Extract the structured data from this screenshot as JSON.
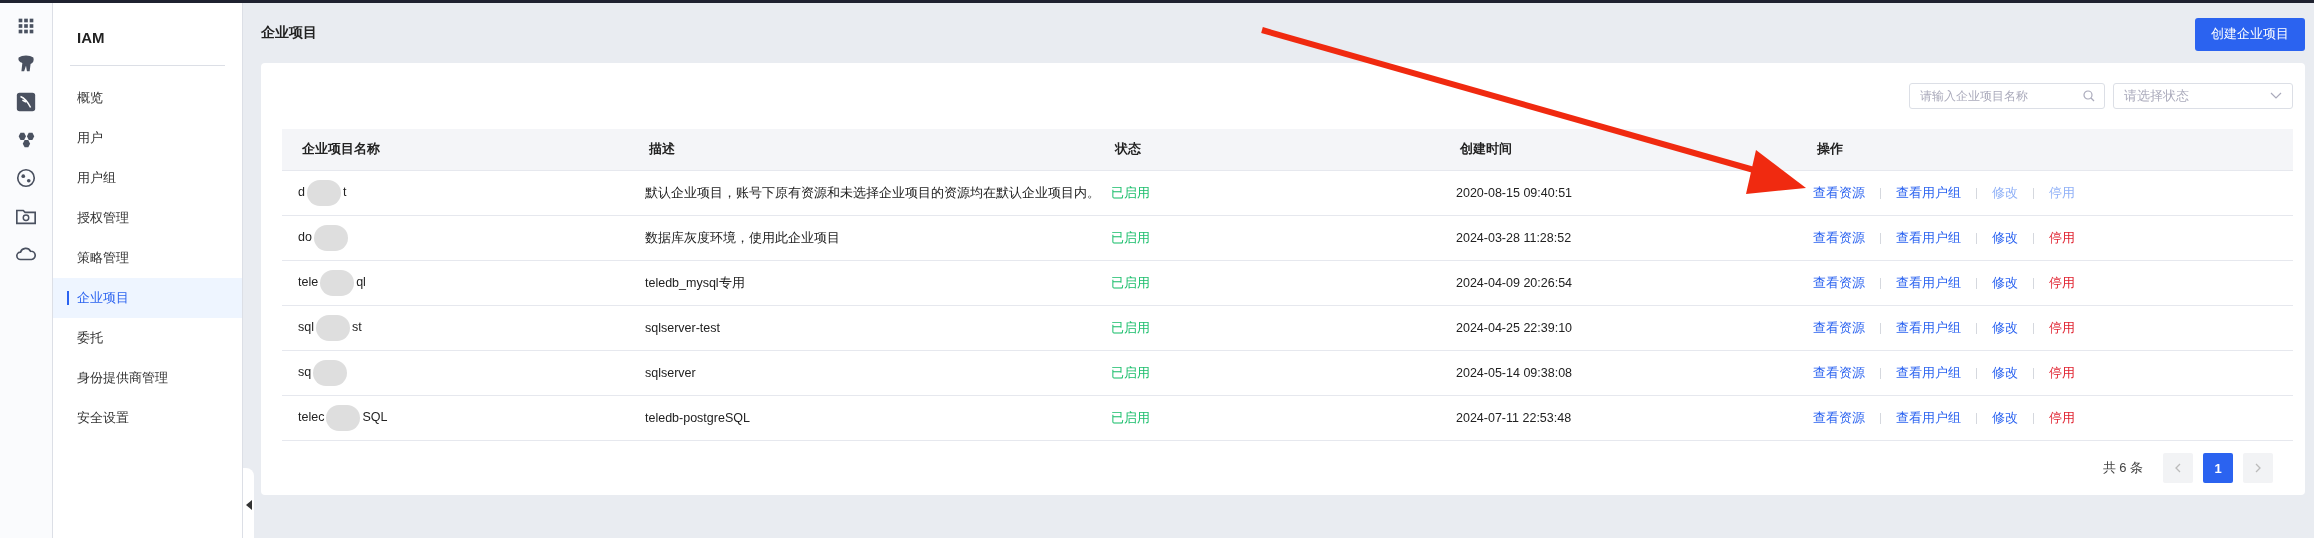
{
  "rail": {
    "icons": [
      {
        "kind": "grid",
        "selected": false
      },
      {
        "kind": "elephant",
        "selected": false
      },
      {
        "kind": "dolphin",
        "selected": false
      },
      {
        "kind": "hexagons",
        "selected": false
      },
      {
        "kind": "orbit",
        "selected": false
      },
      {
        "kind": "folder",
        "selected": false
      },
      {
        "kind": "cloud",
        "selected": false
      }
    ]
  },
  "sidebar": {
    "title": "IAM",
    "items": [
      {
        "label": "概览",
        "selected": false
      },
      {
        "label": "用户",
        "selected": false
      },
      {
        "label": "用户组",
        "selected": false
      },
      {
        "label": "授权管理",
        "selected": false
      },
      {
        "label": "策略管理",
        "selected": false
      },
      {
        "label": "企业项目",
        "selected": true
      },
      {
        "label": "委托",
        "selected": false
      },
      {
        "label": "身份提供商管理",
        "selected": false
      },
      {
        "label": "安全设置",
        "selected": false
      }
    ]
  },
  "page": {
    "title": "企业项目",
    "create_button": "创建企业项目"
  },
  "filters": {
    "search": {
      "placeholder": "请输入企业项目名称"
    },
    "status": {
      "placeholder": "请选择状态"
    }
  },
  "table": {
    "columns": [
      "企业项目名称",
      "描述",
      "状态",
      "创建时间",
      "操作"
    ],
    "rows": [
      {
        "name_parts": [
          "d",
          "t"
        ],
        "description": "默认企业项目，账号下原有资源和未选择企业项目的资源均在默认企业项目内。",
        "status": "已启用",
        "created": "2020-08-15 09:40:51",
        "actions": [
          {
            "label": "查看资源",
            "kind": "link",
            "disabled": false
          },
          {
            "label": "查看用户组",
            "kind": "link",
            "disabled": false
          },
          {
            "label": "修改",
            "kind": "link",
            "disabled": true
          },
          {
            "label": "停用",
            "kind": "danger",
            "disabled": true
          }
        ]
      },
      {
        "name_parts": [
          "do"
        ],
        "description": "数据库灰度环境，使用此企业项目",
        "status": "已启用",
        "created": "2024-03-28 11:28:52",
        "actions": [
          {
            "label": "查看资源",
            "kind": "link",
            "disabled": false
          },
          {
            "label": "查看用户组",
            "kind": "link",
            "disabled": false
          },
          {
            "label": "修改",
            "kind": "link",
            "disabled": false
          },
          {
            "label": "停用",
            "kind": "danger",
            "disabled": false
          }
        ]
      },
      {
        "name_parts": [
          "tele",
          "ql"
        ],
        "description": "teledb_mysql专用",
        "status": "已启用",
        "created": "2024-04-09 20:26:54",
        "actions": [
          {
            "label": "查看资源",
            "kind": "link",
            "disabled": false
          },
          {
            "label": "查看用户组",
            "kind": "link",
            "disabled": false
          },
          {
            "label": "修改",
            "kind": "link",
            "disabled": false
          },
          {
            "label": "停用",
            "kind": "danger",
            "disabled": false
          }
        ]
      },
      {
        "name_parts": [
          "sql",
          "st"
        ],
        "description": "sqlserver-test",
        "status": "已启用",
        "created": "2024-04-25 22:39:10",
        "actions": [
          {
            "label": "查看资源",
            "kind": "link",
            "disabled": false
          },
          {
            "label": "查看用户组",
            "kind": "link",
            "disabled": false
          },
          {
            "label": "修改",
            "kind": "link",
            "disabled": false
          },
          {
            "label": "停用",
            "kind": "danger",
            "disabled": false
          }
        ]
      },
      {
        "name_parts": [
          "sq"
        ],
        "description": "sqlserver",
        "status": "已启用",
        "created": "2024-05-14 09:38:08",
        "actions": [
          {
            "label": "查看资源",
            "kind": "link",
            "disabled": false
          },
          {
            "label": "查看用户组",
            "kind": "link",
            "disabled": false
          },
          {
            "label": "修改",
            "kind": "link",
            "disabled": false
          },
          {
            "label": "停用",
            "kind": "danger",
            "disabled": false
          }
        ]
      },
      {
        "name_parts": [
          "telec",
          "SQL"
        ],
        "description": "teledb-postgreSQL",
        "status": "已启用",
        "created": "2024-07-11 22:53:48",
        "actions": [
          {
            "label": "查看资源",
            "kind": "link",
            "disabled": false
          },
          {
            "label": "查看用户组",
            "kind": "link",
            "disabled": false
          },
          {
            "label": "修改",
            "kind": "link",
            "disabled": false
          },
          {
            "label": "停用",
            "kind": "danger",
            "disabled": false
          }
        ]
      }
    ]
  },
  "pagination": {
    "total": "共 6 条",
    "pages": [
      {
        "label": "1",
        "selected": true
      }
    ]
  }
}
